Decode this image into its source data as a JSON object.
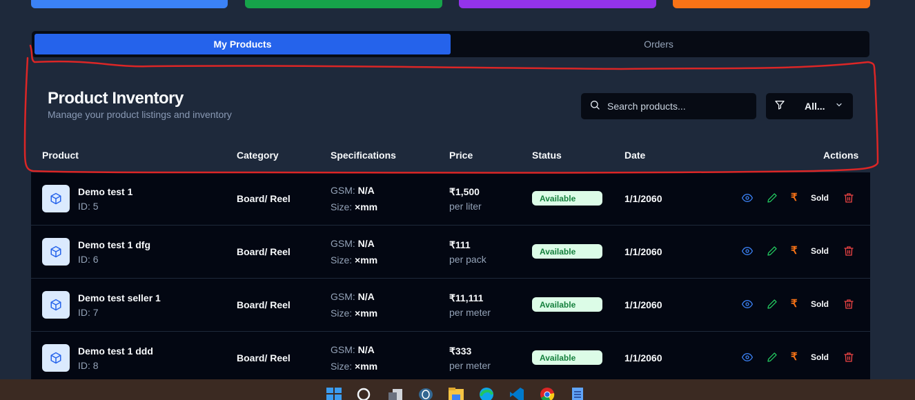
{
  "colors": {
    "card_blue": "#3b82f6",
    "card_green": "#16a34a",
    "card_purple": "#9333ea",
    "card_orange": "#f97316",
    "active_tab": "#2563eb",
    "annotation": "#dc2626"
  },
  "tabs": [
    {
      "label": "My Products",
      "active": true
    },
    {
      "label": "Orders",
      "active": false
    }
  ],
  "inventory": {
    "title": "Product Inventory",
    "subtitle": "Manage your product listings and inventory",
    "search_placeholder": "Search products...",
    "filter_value": "All..."
  },
  "table": {
    "headers": {
      "product": "Product",
      "category": "Category",
      "specifications": "Specifications",
      "price": "Price",
      "status": "Status",
      "date": "Date",
      "actions": "Actions"
    },
    "rows": [
      {
        "name": "Demo test 1",
        "id": "ID: 5",
        "category": "Board/ Reel",
        "gsm_label": "GSM:",
        "gsm": "N/A",
        "size_label": "Size:",
        "size": "×mm",
        "price": "₹1,500",
        "unit": "per liter",
        "status": "Available",
        "date": "1/1/2060",
        "rupee": "₹",
        "sold": "Sold"
      },
      {
        "name": "Demo test 1 dfg",
        "id": "ID: 6",
        "category": "Board/ Reel",
        "gsm_label": "GSM:",
        "gsm": "N/A",
        "size_label": "Size:",
        "size": "×mm",
        "price": "₹111",
        "unit": "per pack",
        "status": "Available",
        "date": "1/1/2060",
        "rupee": "₹",
        "sold": "Sold"
      },
      {
        "name": "Demo test seller 1",
        "id": "ID: 7",
        "category": "Board/ Reel",
        "gsm_label": "GSM:",
        "gsm": "N/A",
        "size_label": "Size:",
        "size": "×mm",
        "price": "₹11,111",
        "unit": "per meter",
        "status": "Available",
        "date": "1/1/2060",
        "rupee": "₹",
        "sold": "Sold"
      },
      {
        "name": "Demo test 1 ddd",
        "id": "ID: 8",
        "category": "Board/ Reel",
        "gsm_label": "GSM:",
        "gsm": "N/A",
        "size_label": "Size:",
        "size": "×mm",
        "price": "₹333",
        "unit": "per meter",
        "status": "Available",
        "date": "1/1/2060",
        "rupee": "₹",
        "sold": "Sold"
      }
    ]
  },
  "taskbar": {
    "icons": [
      "windows-start-icon",
      "search-icon",
      "task-view-icon",
      "postgres-icon",
      "file-explorer-icon",
      "edge-icon",
      "vscode-icon",
      "chrome-icon",
      "notepad-icon"
    ]
  }
}
